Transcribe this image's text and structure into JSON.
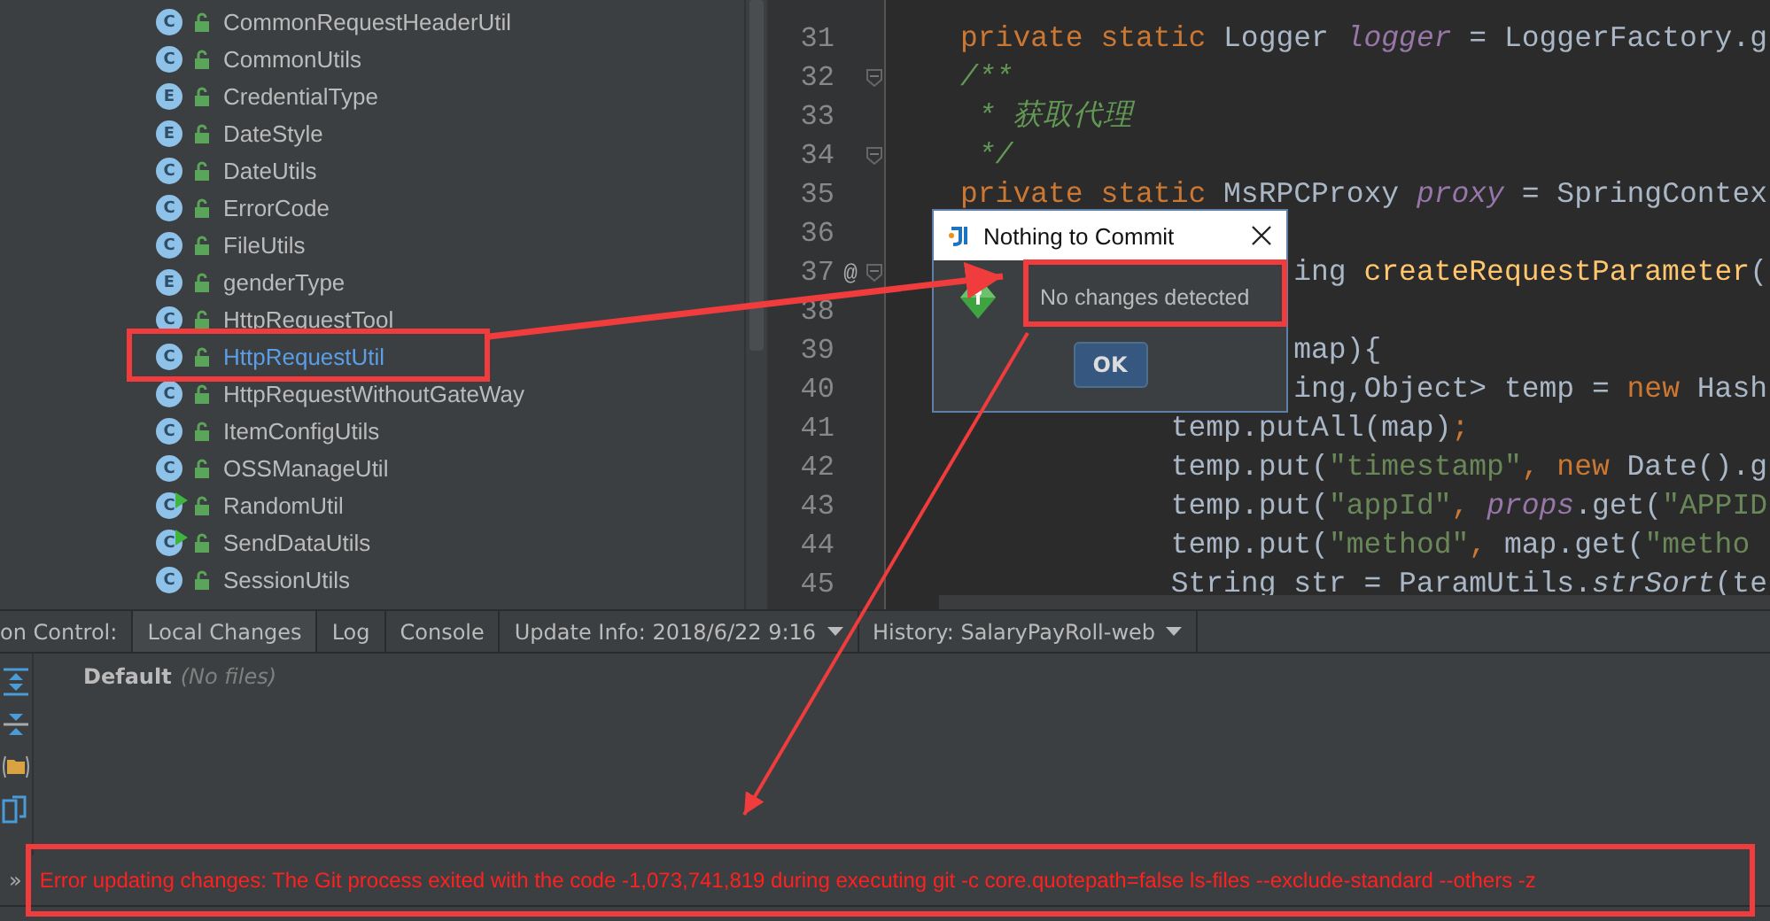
{
  "project_tree": {
    "items": [
      {
        "badge": "C",
        "name": "CommonRequestHeaderUtil",
        "runnable": false,
        "selected": false
      },
      {
        "badge": "C",
        "name": "CommonUtils",
        "runnable": false,
        "selected": false
      },
      {
        "badge": "E",
        "name": "CredentialType",
        "runnable": false,
        "selected": false
      },
      {
        "badge": "E",
        "name": "DateStyle",
        "runnable": false,
        "selected": false
      },
      {
        "badge": "C",
        "name": "DateUtils",
        "runnable": false,
        "selected": false
      },
      {
        "badge": "C",
        "name": "ErrorCode",
        "runnable": false,
        "selected": false
      },
      {
        "badge": "C",
        "name": "FileUtils",
        "runnable": false,
        "selected": false
      },
      {
        "badge": "E",
        "name": "genderType",
        "runnable": false,
        "selected": false
      },
      {
        "badge": "C",
        "name": "HttpRequestTool",
        "runnable": false,
        "selected": false
      },
      {
        "badge": "C",
        "name": "HttpRequestUtil",
        "runnable": false,
        "selected": true
      },
      {
        "badge": "C",
        "name": "HttpRequestWithoutGateWay",
        "runnable": false,
        "selected": false
      },
      {
        "badge": "C",
        "name": "ItemConfigUtils",
        "runnable": false,
        "selected": false
      },
      {
        "badge": "C",
        "name": "OSSManageUtil",
        "runnable": false,
        "selected": false
      },
      {
        "badge": "C",
        "name": "RandomUtil",
        "runnable": true,
        "selected": false
      },
      {
        "badge": "C",
        "name": "SendDataUtils",
        "runnable": true,
        "selected": false
      },
      {
        "badge": "C",
        "name": "SessionUtils",
        "runnable": false,
        "selected": false
      }
    ]
  },
  "editor": {
    "lines": [
      {
        "number": "31",
        "fold": false,
        "tokens": [
          {
            "kind": "keyword",
            "text": "private static"
          },
          {
            "kind": "plain",
            "text": " Logger "
          },
          {
            "kind": "field",
            "text": "logger"
          },
          {
            "kind": "plain",
            "text": " = LoggerFactory.g"
          }
        ]
      },
      {
        "number": "32",
        "fold": true,
        "tokens": [
          {
            "kind": "doc",
            "text": "/**"
          }
        ]
      },
      {
        "number": "33",
        "fold": false,
        "tokens": [
          {
            "kind": "doc",
            "text": " * 获取代理"
          }
        ]
      },
      {
        "number": "34",
        "fold": true,
        "tokens": [
          {
            "kind": "doc",
            "text": " */"
          }
        ]
      },
      {
        "number": "35",
        "fold": false,
        "tokens": [
          {
            "kind": "keyword",
            "text": "private static"
          },
          {
            "kind": "plain",
            "text": " MsRPCProxy "
          },
          {
            "kind": "field",
            "text": "proxy"
          },
          {
            "kind": "plain",
            "text": " = SpringContex"
          }
        ]
      },
      {
        "number": "36",
        "fold": false
      },
      {
        "number": "37",
        "fold": true,
        "annotation": "@",
        "tokens": [
          {
            "kind": "plain",
            "text": "                   ing "
          },
          {
            "kind": "method",
            "text": "createRequestParameter"
          },
          {
            "kind": "plain",
            "text": "("
          }
        ]
      },
      {
        "number": "38",
        "fold": false
      },
      {
        "number": "39",
        "fold": false,
        "tokens": [
          {
            "kind": "plain",
            "text": "                   map){"
          }
        ]
      },
      {
        "number": "40",
        "fold": false,
        "tokens": [
          {
            "kind": "plain",
            "text": "                   ing,Object> temp = "
          },
          {
            "kind": "keyword",
            "text": "new"
          },
          {
            "kind": "plain",
            "text": " Hash"
          }
        ]
      },
      {
        "number": "41",
        "fold": false,
        "tokens": [
          {
            "kind": "plain",
            "text": "            temp.putAll(map)"
          },
          {
            "kind": "keyword",
            "text": ";"
          }
        ]
      },
      {
        "number": "42",
        "fold": false,
        "tokens": [
          {
            "kind": "plain",
            "text": "            temp.put("
          },
          {
            "kind": "string",
            "text": "\"timestamp\""
          },
          {
            "kind": "keyword",
            "text": ", new"
          },
          {
            "kind": "plain",
            "text": " Date().g"
          }
        ]
      },
      {
        "number": "43",
        "fold": false,
        "tokens": [
          {
            "kind": "plain",
            "text": "            temp.put("
          },
          {
            "kind": "string",
            "text": "\"appId\""
          },
          {
            "kind": "keyword",
            "text": ", "
          },
          {
            "kind": "field",
            "text": "props"
          },
          {
            "kind": "plain",
            "text": ".get("
          },
          {
            "kind": "string",
            "text": "\"APPID"
          }
        ]
      },
      {
        "number": "44",
        "fold": false,
        "tokens": [
          {
            "kind": "plain",
            "text": "            temp.put("
          },
          {
            "kind": "string",
            "text": "\"method\""
          },
          {
            "kind": "keyword",
            "text": ", "
          },
          {
            "kind": "plain",
            "text": "map.get("
          },
          {
            "kind": "string",
            "text": "\"metho"
          }
        ]
      },
      {
        "number": "45",
        "fold": false,
        "tokens": [
          {
            "kind": "plain",
            "text": "            String str = ParamUtils."
          },
          {
            "kind": "static",
            "text": "strSort"
          },
          {
            "kind": "plain",
            "text": "(te"
          }
        ]
      }
    ]
  },
  "dialog": {
    "title": "Nothing to Commit",
    "message": "No changes detected",
    "button": "OK"
  },
  "version_control": {
    "label": "on Control:",
    "tabs": [
      {
        "label": "Local Changes",
        "selected": true,
        "dropdown": false
      },
      {
        "label": "Log",
        "selected": false,
        "dropdown": false
      },
      {
        "label": "Console",
        "selected": false,
        "dropdown": false
      },
      {
        "label": "Update Info: 2018/6/22 9:16",
        "selected": false,
        "dropdown": true
      },
      {
        "label": "History: SalaryPayRoll-web",
        "selected": false,
        "dropdown": true
      }
    ],
    "changelist": {
      "name": "Default",
      "note": "(No files)"
    },
    "expand": "»",
    "error": "Error updating changes: The Git process exited with the code -1,073,741,819 during executing git -c core.quotepath=false ls-files --exclude-standard --others -z"
  }
}
